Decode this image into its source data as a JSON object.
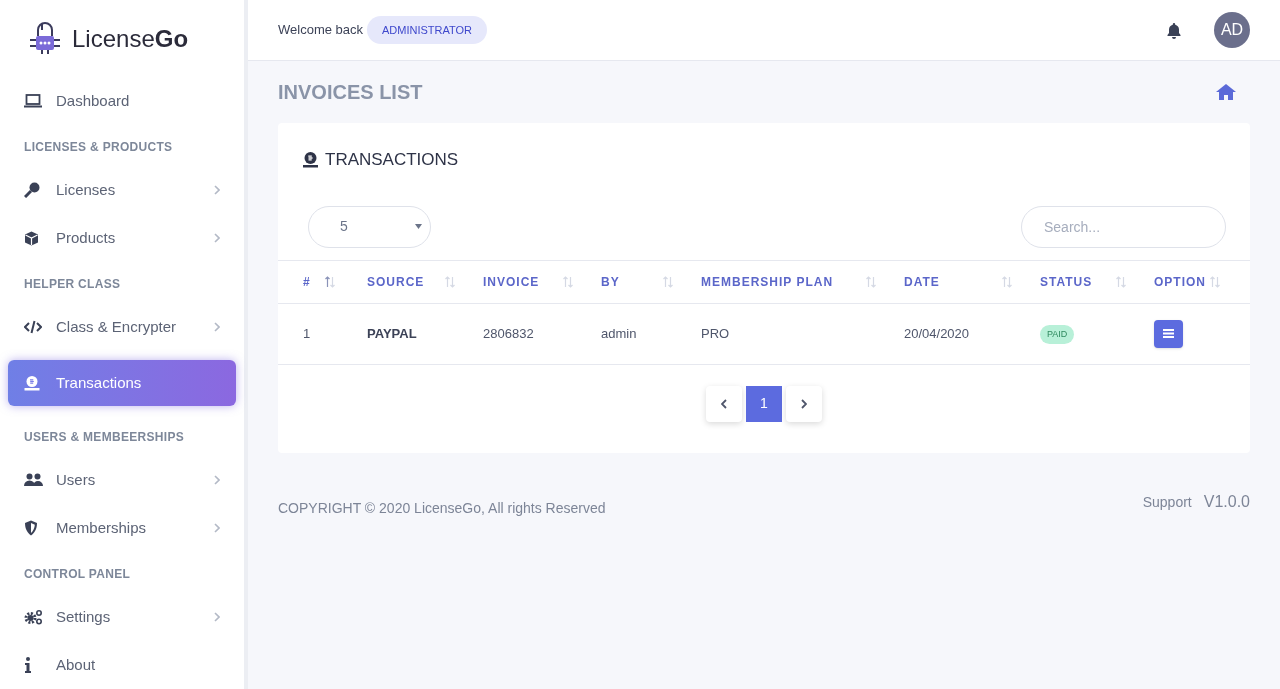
{
  "brand": {
    "name": "License**Go**"
  },
  "sidebar": {
    "items": [
      {
        "kind": "link",
        "label": "Dashboard",
        "arrow": false,
        "selected": false
      },
      {
        "kind": "heading",
        "label": "LICENSES & PRODUCTS"
      },
      {
        "kind": "link",
        "label": "Licenses",
        "arrow": true,
        "selected": false
      },
      {
        "kind": "link",
        "label": "Products",
        "arrow": true,
        "selected": false
      },
      {
        "kind": "heading",
        "label": "HELPER CLASS"
      },
      {
        "kind": "link",
        "label": "Class & Encrypter",
        "arrow": true,
        "selected": false
      },
      {
        "kind": "link",
        "label": "Transactions",
        "arrow": false,
        "selected": true
      },
      {
        "kind": "heading",
        "label": "USERS & MEMBEERSHIPS"
      },
      {
        "kind": "link",
        "label": "Users",
        "arrow": true,
        "selected": false
      },
      {
        "kind": "link",
        "label": "Memberships",
        "arrow": true,
        "selected": false
      },
      {
        "kind": "heading",
        "label": "CONTROL PANEL"
      },
      {
        "kind": "link",
        "label": "Settings",
        "arrow": true,
        "selected": false
      },
      {
        "kind": "link",
        "label": "About",
        "arrow": false,
        "selected": false
      }
    ]
  },
  "header": {
    "welcome": "Welcome back",
    "role": "ADMINISTRATOR",
    "avatar": "AD"
  },
  "page_title": "INVOICES LIST",
  "card": {
    "title": "TRANSACTIONS",
    "page_size": "5",
    "search": {
      "placeholder": "Search..."
    },
    "table": {
      "columns": [
        {
          "label": "#",
          "sorted": true
        },
        {
          "label": "SOURCE",
          "sorted": false
        },
        {
          "label": "INVOICE",
          "sorted": false
        },
        {
          "label": "BY",
          "sorted": false
        },
        {
          "label": "MEMBERSHIP PLAN",
          "sorted": false
        },
        {
          "label": "DATE",
          "sorted": false
        },
        {
          "label": "STATUS",
          "sorted": false
        },
        {
          "label": "OPTION",
          "sorted": false
        }
      ],
      "rows": [
        {
          "index": "1",
          "source": "PAYPAL",
          "invoice": "2806832",
          "by": "admin",
          "plan": "PRO",
          "date": "20/04/2020",
          "status": "PAID"
        }
      ]
    },
    "pagination": [
      {
        "label": "1",
        "selected": true
      }
    ]
  },
  "footer": {
    "copyright": "COPYRIGHT © 2020 LicenseGo, All rights Reserved",
    "support": "Support",
    "version": "V1.0.0"
  }
}
